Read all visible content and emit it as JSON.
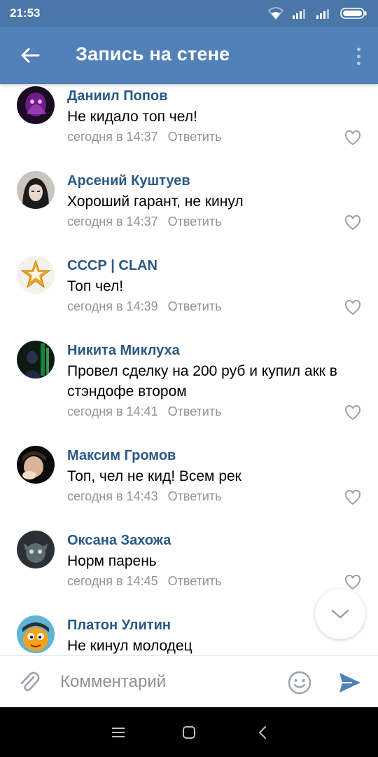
{
  "status_bar": {
    "time": "21:53",
    "icons": [
      "wifi-icon",
      "signal-icon",
      "signal-icon",
      "battery-icon"
    ]
  },
  "app_bar": {
    "title": "Запись на стене",
    "back_icon": "arrow-left-icon",
    "more_icon": "more-vertical-icon"
  },
  "comments": [
    {
      "author": "Даниил Попов",
      "text": "Не кидало топ чел!",
      "time": "сегодня в 14:37",
      "reply_label": "Ответить",
      "avatar": "dark-purple-avatar"
    },
    {
      "author": "Арсений Куштуев",
      "text": "Хороший гарант, не кинул",
      "time": "сегодня в 14:37",
      "reply_label": "Ответить",
      "avatar": "anime-avatar"
    },
    {
      "author": "СССР | CLAN",
      "text": "Топ чел!",
      "time": "сегодня в 14:39",
      "reply_label": "Ответить",
      "avatar": "star-avatar"
    },
    {
      "author": "Никита Миклуха",
      "text": "Провел сделку на 200 руб и купил акк в стэндофе втором",
      "time": "сегодня в 14:41",
      "reply_label": "Ответить",
      "avatar": "green-game-avatar"
    },
    {
      "author": "Максим Громов",
      "text": "Топ, чел не кид! Всем рек",
      "time": "сегодня в 14:43",
      "reply_label": "Ответить",
      "avatar": "photo-avatar"
    },
    {
      "author": "Оксана Захожа",
      "text": "Норм парень",
      "time": "сегодня в 14:45",
      "reply_label": "Ответить",
      "avatar": "creature-avatar"
    },
    {
      "author": "Платон Улитин",
      "text": "Не кинул молодец",
      "time": "",
      "reply_label": "",
      "avatar": "cartoon-avatar"
    }
  ],
  "input_bar": {
    "placeholder": "Комментарий",
    "attach_icon": "paperclip-icon",
    "emoji_icon": "smiley-icon",
    "send_icon": "send-icon"
  },
  "scroll_down_icon": "chevron-down-icon",
  "nav_bar": {
    "icons": [
      "menu-icon",
      "home-icon",
      "back-icon"
    ]
  },
  "colors": {
    "status_bar": "#4a76a8",
    "app_bar": "#5181b8",
    "author_link": "#2a5885",
    "meta_text": "#939393",
    "accent": "#5181b8"
  }
}
